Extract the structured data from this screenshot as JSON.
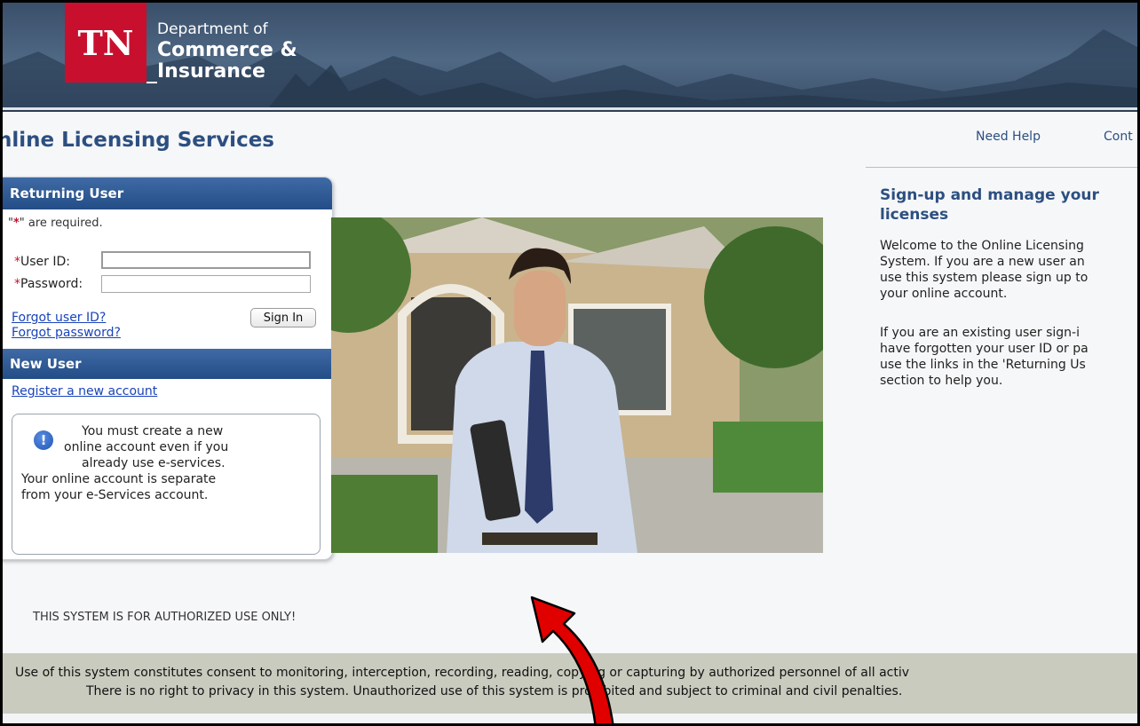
{
  "header": {
    "logo_abbrev": "TN",
    "logo_line1": "Department of",
    "logo_line2": "Commerce &",
    "logo_line3": "Insurance"
  },
  "page": {
    "title": "nline Licensing Services",
    "need_help": "Need Help",
    "contact": "Cont"
  },
  "login": {
    "returning_heading": "Returning User",
    "required_prefix": "\"",
    "required_star": "*",
    "required_suffix": "\" are required.",
    "userid_label": "User ID:",
    "password_label": "Password:",
    "star": "*",
    "userid_value": "",
    "password_value": "",
    "forgot_userid": "Forgot user ID?",
    "forgot_password": "Forgot password?",
    "signin_label": "Sign In",
    "new_heading": "New User",
    "register": "Register a new account"
  },
  "notice": {
    "icon": "info-exclamation-icon",
    "line1": "You must create a new",
    "line2": "online account even if you",
    "line3": "already use e-services.",
    "line4": "Your online account is separate",
    "line5": "from your e-Services account."
  },
  "info": {
    "title_line1": "Sign-up and manage your",
    "title_line2": "licenses",
    "para1_line1": "Welcome to the Online Licensing",
    "para1_line2": "System. If you are a new user an",
    "para1_line3": "use this system please sign up to",
    "para1_line4": "your online account.",
    "para2_line1": "If you are an existing user sign-i",
    "para2_line2": "have forgotten your user ID or pa",
    "para2_line3": "use the links in the 'Returning Us",
    "para2_line4": "section to help you."
  },
  "footer": {
    "authorized": "THIS SYSTEM IS FOR AUTHORIZED USE ONLY!",
    "consent_line1": "Use of this system constitutes consent to monitoring, interception, recording, reading, copying or capturing by authorized personnel of all activ",
    "consent_line2": "There is no right to privacy in this system. Unauthorized use of this system is prohibited and subject to criminal and civil penalties."
  },
  "colors": {
    "brand_red": "#c8102e",
    "heading_blue": "#2c4f80",
    "panel_blue": "#234d86",
    "link_blue": "#1a44b8",
    "consent_bg": "#c9cbbf",
    "annotation_arrow": "#e00000"
  }
}
